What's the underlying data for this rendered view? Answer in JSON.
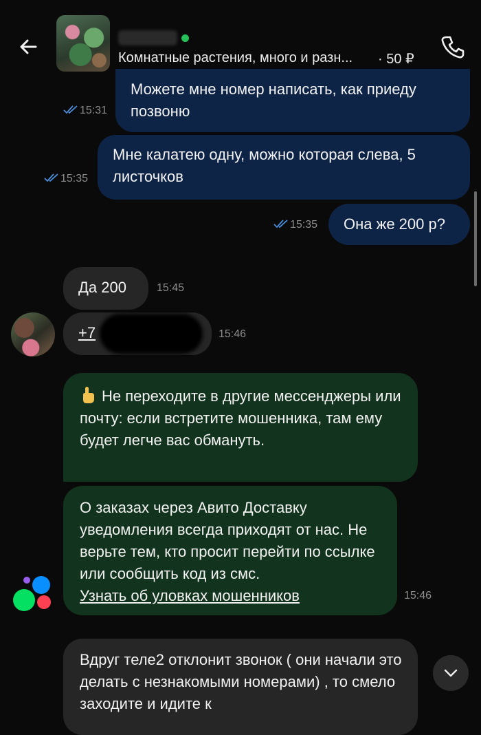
{
  "header": {
    "listing_title": "Комнатные растения, много и разн...",
    "listing_price": "· 50 ₽",
    "online": true
  },
  "icons": {
    "back": "arrow-left-icon",
    "call": "phone-icon",
    "read": "double-check-icon",
    "warning": "pointing-up-emoji",
    "scroll": "chevron-down-icon"
  },
  "colors": {
    "outgoing_bubble": "#0e2447",
    "incoming_bubble": "#262626",
    "system_bubble": "#12331d",
    "read_check": "#4a8fe0",
    "online": "#25c05a"
  },
  "messages": [
    {
      "direction": "out",
      "text": "Можете мне номер написать, как приеду позвоню",
      "time": "15:31"
    },
    {
      "direction": "out",
      "text": "Мне калатею одну, можно которая слева, 5 листочков",
      "time": "15:35"
    },
    {
      "direction": "out",
      "text": "Она же 200 р?",
      "time": "15:35"
    },
    {
      "direction": "in",
      "text": "Да 200",
      "time": "15:45"
    },
    {
      "direction": "in",
      "text": "+7",
      "time": "15:46"
    }
  ],
  "system_messages": {
    "warning_text": "Не переходите в другие мессенджеры или почту: если встретите мошенника, там ему будет легче вас обмануть.",
    "info_text": "О заказах через Авито Доставку уведомления всегда приходят от нас. Не верьте тем, кто просит перейти по ссылке или сообщить код из смс.",
    "link_text": "Узнать об уловках мошенников",
    "time": "15:46"
  },
  "last_message": {
    "direction": "in",
    "text": "Вдруг теле2  отклонит звонок ( они начали это делать с незнакомыми номерами) , то смело заходите и идите к"
  }
}
